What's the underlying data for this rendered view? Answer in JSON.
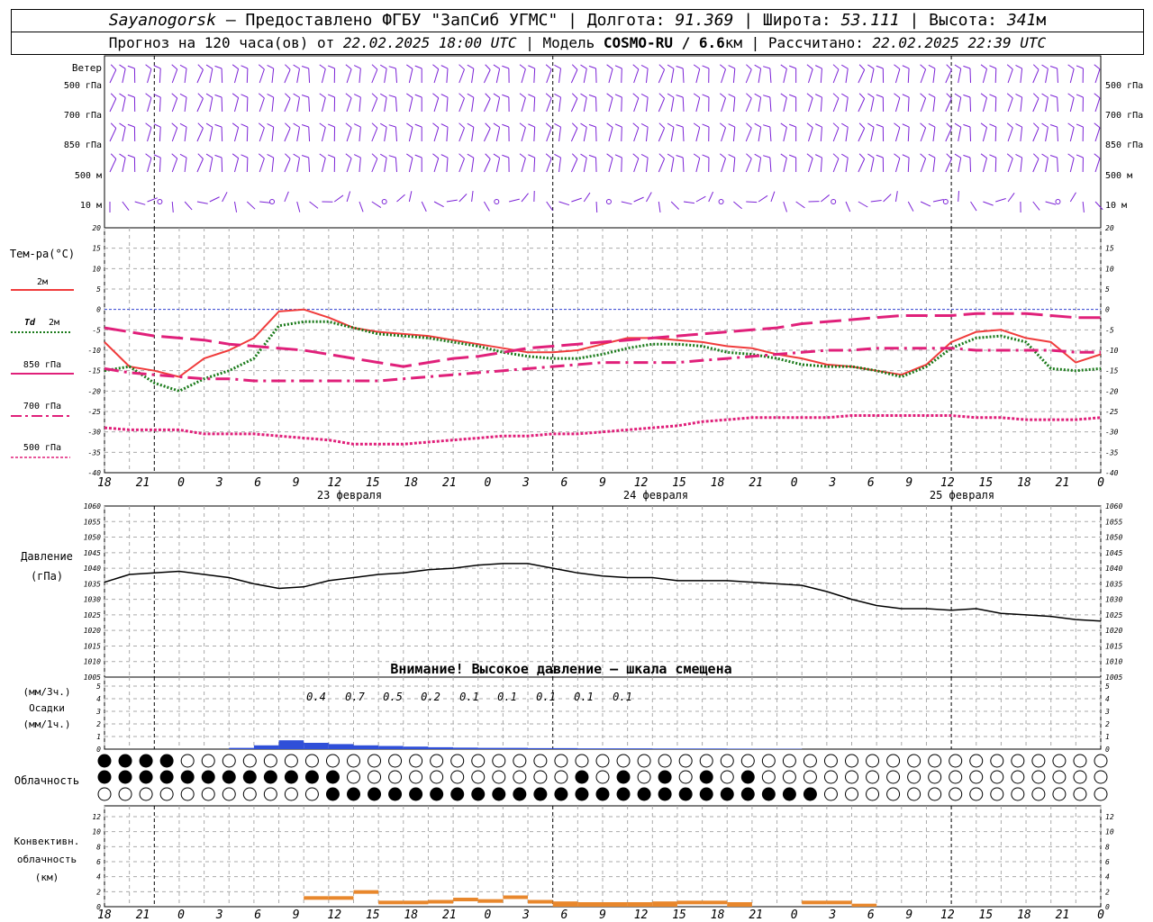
{
  "header": {
    "station": "Sayanogorsk",
    "provider": "— Предоставлено ФГБУ \"ЗапСиб УГМС\"",
    "lon_label": "Долгота:",
    "lon": "91.369",
    "lat_label": "Широта:",
    "lat": "53.111",
    "alt_label": "Высота:",
    "alt": "341",
    "alt_unit": "м",
    "forecast_label": "Прогноз на 120 часа(ов) от",
    "forecast_time": "22.02.2025 18:00 UTC",
    "model_label": "| Модель",
    "model": "COSMO-RU / 6.6",
    "model_unit": "км",
    "calc_label": "| Рассчитано:",
    "calc_time": "22.02.2025 22:39 UTC"
  },
  "wind": {
    "title": "Ветер",
    "levels": [
      "500 гПа",
      "700 гПа",
      "850 гПа",
      "500 м",
      "10 м"
    ],
    "color": "#7b22d6"
  },
  "temperature": {
    "title": "Тем-ра(°C)",
    "legend": [
      {
        "label": "2м",
        "color": "#f03c3c",
        "style": "solid"
      },
      {
        "label_it": "Td",
        "label": "2м",
        "color": "#1a7a1a",
        "style": "dotted"
      },
      {
        "label": "850 гПа",
        "color": "#e0207a",
        "style": "dash"
      },
      {
        "label": "700 гПа",
        "color": "#e0207a",
        "style": "dashdot"
      },
      {
        "label": "500 гПа",
        "color": "#e0207a",
        "style": "dot"
      }
    ]
  },
  "dates": [
    "23 февраля",
    "24 февраля",
    "25 февраля"
  ],
  "hour_labels": [
    "18",
    "21",
    "0",
    "3",
    "6",
    "9",
    "12",
    "15",
    "18",
    "21",
    "0",
    "3",
    "6",
    "9",
    "12",
    "15",
    "18",
    "21",
    "0",
    "3",
    "6",
    "9",
    "12",
    "15",
    "18",
    "21",
    "0"
  ],
  "pressure": {
    "title": "Давление",
    "unit": "(гПа)",
    "warning": "Внимание! Высокое давление — шкала смещена"
  },
  "precip": {
    "unit1": "(мм/3ч.)",
    "title": "Осадки",
    "unit2": "(мм/1ч.)",
    "labels": [
      "0.4",
      "0.7",
      "0.5",
      "0.2",
      "0.1",
      "0.1",
      "0.1",
      "0.1",
      "0.1"
    ]
  },
  "cloud": {
    "title": "Облачность"
  },
  "convective": {
    "title1": "Конвективн.",
    "title2": "облачность",
    "title3": "(км)"
  },
  "chart_data": [
    {
      "type": "line",
      "title": "Тем-ра(°C)",
      "x_hours": [
        0,
        3,
        6,
        9,
        12,
        15,
        18,
        21,
        24,
        27,
        30,
        33,
        36,
        39,
        42,
        45,
        48,
        51,
        54,
        57,
        60,
        63,
        66,
        69,
        72,
        75,
        78,
        81,
        84,
        87,
        90,
        93,
        96,
        99,
        102,
        105,
        108,
        111,
        114,
        117,
        120
      ],
      "ylim": [
        -40,
        20
      ],
      "series": [
        {
          "name": "2м",
          "values": [
            -8,
            -14,
            -15,
            -16.5,
            -12,
            -10,
            -7,
            -0.5,
            0,
            -2,
            -4.5,
            -5.5,
            -6,
            -6.5,
            -7.5,
            -8.5,
            -9.5,
            -10.5,
            -10.5,
            -10,
            -8.5,
            -7,
            -7,
            -7.5,
            -8,
            -9,
            -9.5,
            -11,
            -12,
            -13.5,
            -14,
            -15,
            -16,
            -13.5,
            -8,
            -5.5,
            -5,
            -7,
            -8,
            -13,
            -11
          ]
        },
        {
          "name": "Td 2м",
          "values": [
            -15,
            -14,
            -18,
            -20,
            -17,
            -15,
            -12,
            -4,
            -3,
            -3,
            -4.5,
            -6,
            -6.5,
            -7,
            -8,
            -9,
            -10.5,
            -11.5,
            -12,
            -12,
            -11,
            -9.5,
            -8.5,
            -8.5,
            -9,
            -10.5,
            -11,
            -12,
            -13.5,
            -14,
            -14,
            -15,
            -16.5,
            -14,
            -9.5,
            -7,
            -6.5,
            -8,
            -14.5,
            -15,
            -14.5
          ]
        },
        {
          "name": "850 гПа",
          "values": [
            -4.5,
            -5.5,
            -6.5,
            -7,
            -7.5,
            -8.5,
            -9,
            -9.5,
            -10,
            -11,
            -12,
            -13,
            -14,
            -13,
            -12,
            -11.5,
            -10.5,
            -9.5,
            -9,
            -8.5,
            -8,
            -7.5,
            -7,
            -6.5,
            -6,
            -5.5,
            -5,
            -4.5,
            -3.5,
            -3,
            -2.5,
            -2,
            -1.5,
            -1.5,
            -1.5,
            -1,
            -1,
            -1,
            -1.5,
            -2,
            -2
          ]
        },
        {
          "name": "700 гПа",
          "values": [
            -14.5,
            -15.5,
            -16,
            -16.5,
            -17,
            -17,
            -17.5,
            -17.5,
            -17.5,
            -17.5,
            -17.5,
            -17.5,
            -17,
            -16.5,
            -16,
            -15.5,
            -15,
            -14.5,
            -14,
            -13.5,
            -13,
            -13,
            -13,
            -13,
            -12.5,
            -12,
            -11.5,
            -11,
            -10.5,
            -10,
            -10,
            -9.5,
            -9.5,
            -9.5,
            -9.5,
            -10,
            -10,
            -10,
            -10,
            -10.5,
            -10.5
          ]
        },
        {
          "name": "500 гПа",
          "values": [
            -29,
            -29.5,
            -29.5,
            -29.5,
            -30.5,
            -30.5,
            -30.5,
            -31,
            -31.5,
            -32,
            -33,
            -33,
            -33,
            -32.5,
            -32,
            -31.5,
            -31,
            -31,
            -30.5,
            -30.5,
            -30,
            -29.5,
            -29,
            -28.5,
            -27.5,
            -27,
            -26.5,
            -26.5,
            -26.5,
            -26.5,
            -26,
            -26,
            -26,
            -26,
            -26,
            -26.5,
            -26.5,
            -27,
            -27,
            -27,
            -26.5
          ]
        }
      ]
    },
    {
      "type": "line",
      "title": "Давление",
      "ylabel": "(гПа)",
      "ylim": [
        1005,
        1060
      ],
      "x_hours": [
        0,
        3,
        6,
        9,
        12,
        15,
        18,
        21,
        24,
        27,
        30,
        33,
        36,
        39,
        42,
        45,
        48,
        51,
        54,
        57,
        60,
        63,
        66,
        69,
        72,
        75,
        78,
        81,
        84,
        87,
        90,
        93,
        96,
        99,
        102,
        105,
        108,
        111,
        114,
        117,
        120
      ],
      "series": [
        {
          "name": "Давление",
          "values": [
            1035.5,
            1038,
            1038.5,
            1039,
            1038,
            1037,
            1035,
            1033.5,
            1034,
            1036,
            1037,
            1038,
            1038.5,
            1039.5,
            1040,
            1041,
            1041.5,
            1041.5,
            1040,
            1038.5,
            1037.5,
            1037,
            1037,
            1036,
            1036,
            1036,
            1035.5,
            1035,
            1034.5,
            1032.5,
            1030,
            1028,
            1027,
            1027,
            1026.5,
            1027,
            1025.5,
            1025,
            1024.5,
            1023.5,
            1023
          ]
        }
      ]
    },
    {
      "type": "bar",
      "title": "Осадки",
      "ylabel": "(мм/3ч.) (мм/1ч.)",
      "ylim": [
        0,
        5
      ],
      "x_hours": [
        15,
        18,
        21,
        24,
        27,
        30,
        33,
        36,
        39,
        42,
        45,
        48,
        51,
        54,
        57,
        60,
        63,
        66,
        69,
        72,
        75,
        78,
        81
      ],
      "values": [
        0.1,
        0.3,
        0.7,
        0.5,
        0.4,
        0.3,
        0.25,
        0.2,
        0.15,
        0.12,
        0.1,
        0.1,
        0.08,
        0.08,
        0.06,
        0.06,
        0.06,
        0.05,
        0.05,
        0.05,
        0.04,
        0.03,
        0.03
      ],
      "annotations": [
        "0.4",
        "0.7",
        "0.5",
        "0.2",
        "0.1",
        "0.1",
        "0.1",
        "0.1",
        "0.1"
      ]
    },
    {
      "type": "bar",
      "title": "Конвективн. облачность",
      "ylabel": "(км)",
      "ylim": [
        0,
        13
      ],
      "x_hours": [
        24,
        27,
        30,
        33,
        36,
        39,
        42,
        45,
        48,
        51,
        54,
        57,
        60,
        63,
        66,
        69,
        72,
        75,
        78,
        81,
        84,
        87,
        90,
        93,
        96,
        99,
        102,
        105,
        108,
        111,
        114,
        117,
        120
      ],
      "values": [
        1.4,
        1.4,
        2.2,
        0.8,
        0.8,
        0.9,
        1.2,
        1.0,
        1.5,
        0.9,
        0.7,
        0.6,
        0.6,
        0.6,
        0.7,
        0.8,
        0.8,
        0.6,
        0,
        0,
        0.8,
        0.8,
        0.4,
        0,
        0,
        0,
        0,
        0,
        0,
        0,
        0,
        0,
        0
      ]
    }
  ]
}
